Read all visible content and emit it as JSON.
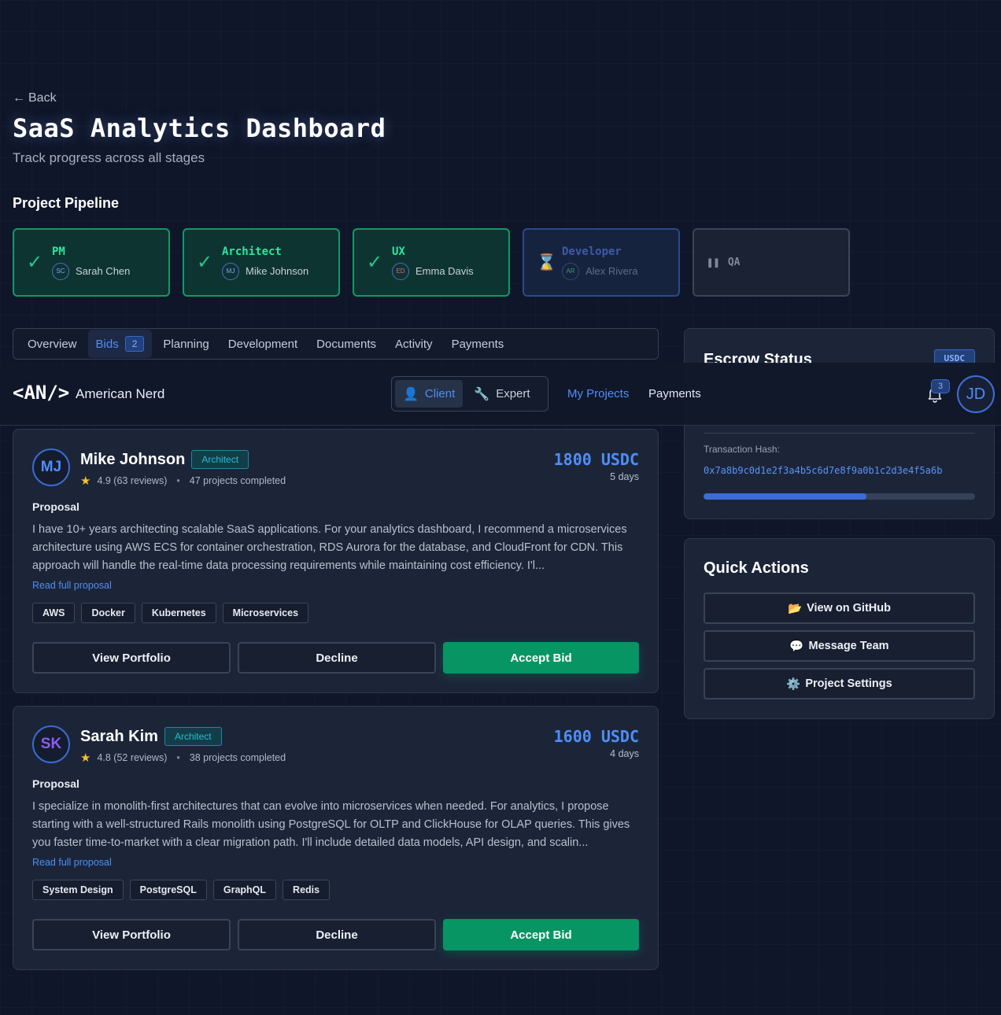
{
  "header": {
    "back_label": "Back",
    "title": "SaaS Analytics Dashboard",
    "subtitle": "Track progress across all stages"
  },
  "pipeline": {
    "title": "Project Pipeline",
    "stages": [
      {
        "role": "PM",
        "initials": "SC",
        "person": "Sarah Chen",
        "status": "complete"
      },
      {
        "role": "Architect",
        "initials": "MJ",
        "person": "Mike Johnson",
        "status": "complete"
      },
      {
        "role": "UX",
        "initials": "ED",
        "person": "Emma Davis",
        "status": "complete"
      },
      {
        "role": "Developer",
        "initials": "AR",
        "person": "Alex Rivera",
        "status": "in-progress"
      },
      {
        "role": "QA",
        "initials": "",
        "person": "",
        "status": "pending"
      }
    ]
  },
  "tabs": [
    {
      "label": "Overview"
    },
    {
      "label": "Bids",
      "count": "2"
    },
    {
      "label": "Planning"
    },
    {
      "label": "Development"
    },
    {
      "label": "Documents"
    },
    {
      "label": "Activity"
    },
    {
      "label": "Payments"
    }
  ],
  "nav": {
    "logo": "<AN/>",
    "brand": "American Nerd",
    "roles": [
      "Client",
      "Expert"
    ],
    "links": [
      "My Projects",
      "Payments"
    ],
    "notifications": "3",
    "user_initials": "JD"
  },
  "escrow": {
    "title": "Escrow Status",
    "badge": "USDC",
    "tx_label": "Transaction Hash:",
    "tx_hash": "0x7a8b9c0d1e2f3a4b5c6d7e8f9a0b1c2d3e4f5a6b",
    "progress": 0.6
  },
  "bids": [
    {
      "initials": "MJ",
      "name": "Mike Johnson",
      "role": "Architect",
      "rating": "4.9 (63 reviews)",
      "projects": "47 projects completed",
      "amount": "1800 USDC",
      "duration": "5 days",
      "proposal_label": "Proposal",
      "proposal": "I have 10+ years architecting scalable SaaS applications. For your analytics dashboard, I recommend a microservices architecture using AWS ECS for container orchestration, RDS Aurora for the database, and CloudFront for CDN. This approach will handle the real-time data processing requirements while maintaining cost efficiency. I'l...",
      "read_more": "Read full proposal",
      "skills": [
        "AWS",
        "Docker",
        "Kubernetes",
        "Microservices"
      ],
      "actions": {
        "portfolio": "View Portfolio",
        "decline": "Decline",
        "accept": "Accept Bid"
      }
    },
    {
      "initials": "SK",
      "name": "Sarah Kim",
      "role": "Architect",
      "rating": "4.8 (52 reviews)",
      "projects": "38 projects completed",
      "amount": "1600 USDC",
      "duration": "4 days",
      "proposal_label": "Proposal",
      "proposal": "I specialize in monolith-first architectures that can evolve into microservices when needed. For analytics, I propose starting with a well-structured Rails monolith using PostgreSQL for OLTP and ClickHouse for OLAP queries. This gives you faster time-to-market with a clear migration path. I'll include detailed data models, API design, and scalin...",
      "read_more": "Read full proposal",
      "skills": [
        "System Design",
        "PostgreSQL",
        "GraphQL",
        "Redis"
      ],
      "actions": {
        "portfolio": "View Portfolio",
        "decline": "Decline",
        "accept": "Accept Bid"
      }
    }
  ],
  "quick_actions": {
    "title": "Quick Actions",
    "items": [
      {
        "icon": "folder-icon",
        "glyph": "📂",
        "label": "View on GitHub"
      },
      {
        "icon": "speech-bubble-icon",
        "glyph": "💬",
        "label": "Message Team"
      },
      {
        "icon": "gear-icon",
        "glyph": "⚙️",
        "label": "Project Settings"
      }
    ]
  },
  "colors": {
    "accent": "#4f8ef7",
    "success": "#079563",
    "background": "#0f1629",
    "card": "#1c2538"
  }
}
